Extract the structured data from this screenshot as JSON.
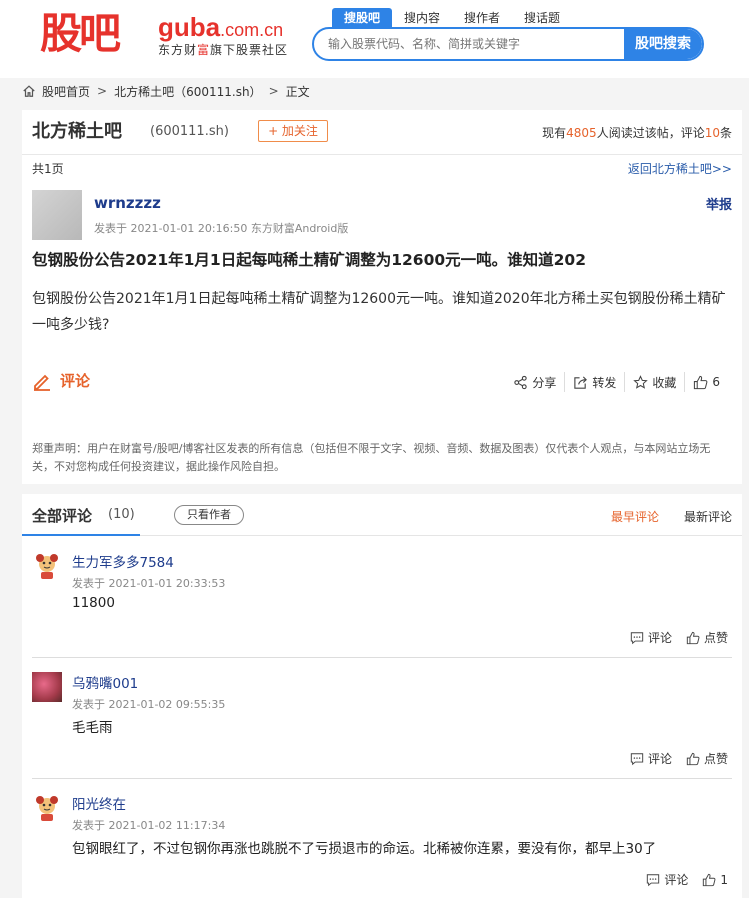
{
  "header": {
    "logo_cn": "股吧",
    "logo_en_main": "guba",
    "logo_en_domain": ".com.cn",
    "logo_sub_pre": "东方财",
    "logo_sub_em": "富",
    "logo_sub_post": "旗下股票社区",
    "search_tabs": [
      "搜股吧",
      "搜内容",
      "搜作者",
      "搜话题"
    ],
    "search_placeholder": "输入股票代码、名称、简拼或关键字",
    "search_button": "股吧搜索"
  },
  "breadcrumb": {
    "items": [
      "股吧首页",
      "北方稀土吧（600111.sh）",
      "正文"
    ],
    "separator": ">"
  },
  "post_header": {
    "bar_name": "北方稀土吧",
    "bar_code": "(600111.sh)",
    "follow_label": "+ 加关注",
    "read_pre": "现有",
    "read_count": "4805",
    "read_mid": "人阅读过该帖，评论",
    "comment_count": "10",
    "read_post": "条",
    "pages": "共1页",
    "back_link": "返回北方稀土吧>>"
  },
  "post": {
    "author": "wrnzzzz",
    "meta": "发表于 2021-01-01 20:16:50 东方财富Android版",
    "report": "举报",
    "title": "包钢股份公告2021年1月1日起每吨稀土精矿调整为12600元一吨。谁知道202",
    "body": "包钢股份公告2021年1月1日起每吨稀土精矿调整为12600元一吨。谁知道2020年北方稀土买包钢股份稀土精矿一吨多少钱?",
    "comment_label": "评论",
    "actions": {
      "share": "分享",
      "forward": "转发",
      "collect": "收藏",
      "like": "6"
    },
    "disclaimer": "郑重声明：用户在财富号/股吧/博客社区发表的所有信息（包括但不限于文字、视频、音频、数据及图表）仅代表个人观点，与本网站立场无关，不对您构成任何投资建议，据此操作风险自担。"
  },
  "comments_section": {
    "tab_all": "全部评论",
    "tab_count": "(10)",
    "only_author": "只看作者",
    "sort_early": "最早评论",
    "sort_new": "最新评论",
    "items": [
      {
        "name": "生力军多多7584",
        "time": "发表于 2021-01-01 20:33:53",
        "text": "11800",
        "reply": "评论",
        "like": "点赞"
      },
      {
        "name": "乌鸦嘴001",
        "time": "发表于 2021-01-02 09:55:35",
        "text": "毛毛雨",
        "reply": "评论",
        "like": "点赞"
      },
      {
        "name": "阳光终在",
        "time": "发表于 2021-01-02 11:17:34",
        "text": "包钢眼红了，不过包钢你再涨也跳脱不了亏损退市的命运。北稀被你连累，要没有你，都早上30了",
        "reply": "评论",
        "like": "1"
      }
    ]
  },
  "colors": {
    "brand_red": "#e6322c",
    "brand_blue": "#2e83e6",
    "accent_orange": "#e6632c",
    "link_blue": "#1e3c8c"
  }
}
